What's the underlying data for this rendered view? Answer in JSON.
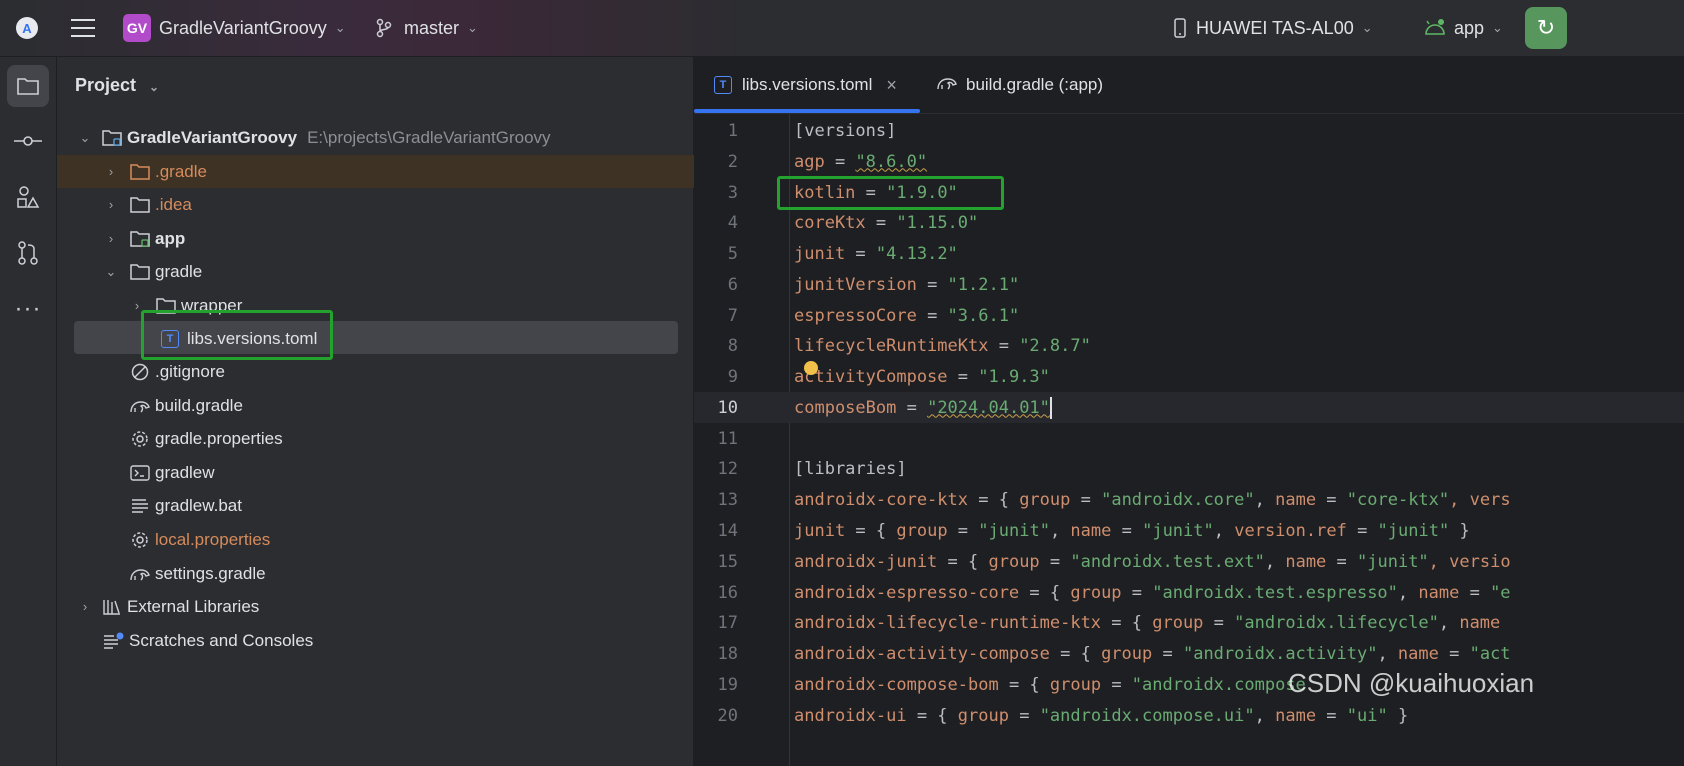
{
  "titlebar": {
    "project_badge": "GV",
    "project_name": "GradleVariantGroovy",
    "branch": "master",
    "device": "HUAWEI TAS-AL00",
    "run_config": "app"
  },
  "project_panel": {
    "header": "Project",
    "root": {
      "name": "GradleVariantGroovy",
      "path": "E:\\projects\\GradleVariantGroovy"
    },
    "items": [
      {
        "label": ".gradle"
      },
      {
        "label": ".idea"
      },
      {
        "label": "app"
      },
      {
        "label": "gradle"
      },
      {
        "label": "wrapper"
      },
      {
        "label": "libs.versions.toml"
      },
      {
        "label": ".gitignore"
      },
      {
        "label": "build.gradle"
      },
      {
        "label": "gradle.properties"
      },
      {
        "label": "gradlew"
      },
      {
        "label": "gradlew.bat"
      },
      {
        "label": "local.properties"
      },
      {
        "label": "settings.gradle"
      },
      {
        "label": "External Libraries"
      },
      {
        "label": "Scratches and Consoles"
      }
    ]
  },
  "tabs": [
    {
      "label": "libs.versions.toml",
      "active": true
    },
    {
      "label": "build.gradle (:app)",
      "active": false
    }
  ],
  "editor": {
    "line_numbers": [
      "1",
      "2",
      "3",
      "4",
      "5",
      "6",
      "7",
      "8",
      "9",
      "10",
      "11",
      "12",
      "13",
      "14",
      "15",
      "16",
      "17",
      "18",
      "19",
      "20"
    ],
    "lines": {
      "l1": "[versions]",
      "l2_key": "agp",
      "l2_val": "\"8.6.0\"",
      "l3_key": "kotlin",
      "l3_val": "\"1.9.0\"",
      "l4_key": "coreKtx",
      "l4_val": "\"1.15.0\"",
      "l5_key": "junit",
      "l5_val": "\"4.13.2\"",
      "l6_key": "junitVersion",
      "l6_val": "\"1.2.1\"",
      "l7_key": "espressoCore",
      "l7_val": "\"3.6.1\"",
      "l8_key": "lifecycleRuntimeKtx",
      "l8_val": "\"2.8.7\"",
      "l9_key": "activityCompose",
      "l9_val": "\"1.9.3\"",
      "l10_key": "composeBom",
      "l10_val": "\"2024.04.01\"",
      "l12": "[libraries]",
      "l13": {
        "key": "androidx-core-ktx",
        "group": "\"androidx.core\"",
        "name": "\"core-ktx\"",
        "tail": ", vers"
      },
      "l14": {
        "key": "junit",
        "group": "\"junit\"",
        "name": "\"junit\"",
        "ref": "\"junit\""
      },
      "l15": {
        "key": "androidx-junit",
        "group": "\"androidx.test.ext\"",
        "name": "\"junit\"",
        "tail": ", versio"
      },
      "l16": {
        "key": "androidx-espresso-core",
        "group": "\"androidx.test.espresso\"",
        "tail": "\"e"
      },
      "l17": {
        "key": "androidx-lifecycle-runtime-ktx",
        "group": "\"androidx.lifecycle\""
      },
      "l18": {
        "key": "androidx-activity-compose",
        "group": "\"androidx.activity\"",
        "tail": "\"act"
      },
      "l19": {
        "key": "androidx-compose-bom",
        "group": "\"androidx.compose"
      },
      "l20": {
        "key": "androidx-ui",
        "group": "\"androidx.compose.ui\"",
        "name": "\"ui\""
      }
    }
  },
  "watermark": "CSDN @kuaihuoxian"
}
